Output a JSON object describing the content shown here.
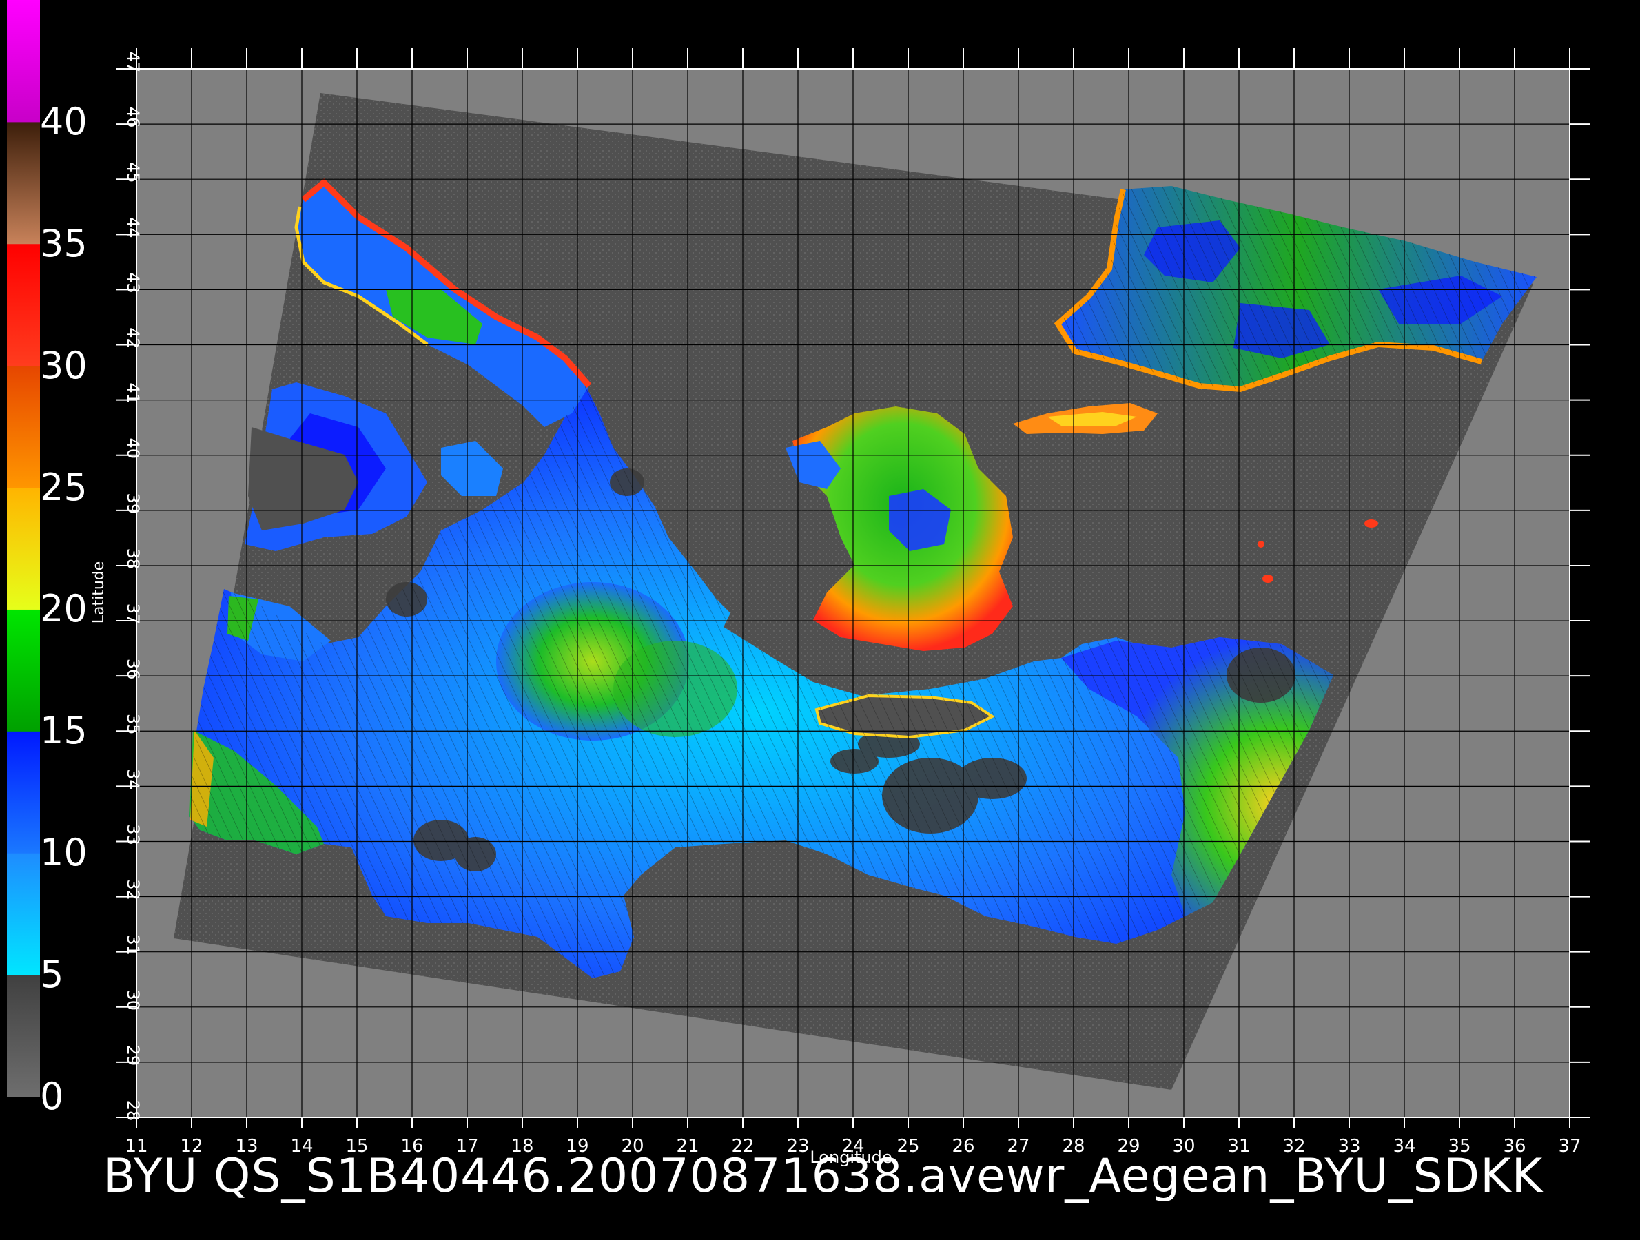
{
  "title": "BYU  QS_S1B40446.20070871638.avewr_Aegean_BYU_SDKK",
  "colorbar": {
    "labels": [
      "0",
      "5",
      "10",
      "15",
      "20",
      "25",
      "30",
      "35",
      "40"
    ],
    "segments": [
      {
        "from": 0,
        "to": 5,
        "colors": [
          "#6e6e6e",
          "#404040"
        ]
      },
      {
        "from": 5,
        "to": 10,
        "colors": [
          "#00e6ff",
          "#1e8cff"
        ]
      },
      {
        "from": 10,
        "to": 15,
        "colors": [
          "#1a78ff",
          "#0019ff"
        ]
      },
      {
        "from": 15,
        "to": 20,
        "colors": [
          "#00a000",
          "#00e600"
        ]
      },
      {
        "from": 20,
        "to": 25,
        "colors": [
          "#e6ff1a",
          "#ffb400"
        ]
      },
      {
        "from": 25,
        "to": 30,
        "colors": [
          "#ff9600",
          "#e64600"
        ]
      },
      {
        "from": 30,
        "to": 35,
        "colors": [
          "#ff3c1e",
          "#ff0000"
        ]
      },
      {
        "from": 35,
        "to": 40,
        "colors": [
          "#c8825a",
          "#3c1e0a"
        ]
      },
      {
        "from": 40,
        "to": 45,
        "colors": [
          "#c800c8",
          "#ff00ff"
        ]
      }
    ]
  },
  "axes": {
    "xlabel": "Longitude",
    "ylabel": "Latitude",
    "lon_range": [
      11,
      37
    ],
    "lat_range": [
      28,
      47
    ],
    "lon_ticks": [
      "11",
      "12",
      "13",
      "14",
      "15",
      "16",
      "17",
      "18",
      "19",
      "20",
      "21",
      "22",
      "23",
      "24",
      "25",
      "26",
      "27",
      "28",
      "29",
      "30",
      "31",
      "32",
      "33",
      "34",
      "35",
      "36",
      "37"
    ],
    "lat_ticks": [
      "28",
      "29",
      "30",
      "31",
      "32",
      "33",
      "34",
      "35",
      "36",
      "37",
      "38",
      "39",
      "40",
      "41",
      "42",
      "43",
      "44",
      "45",
      "46",
      "47"
    ]
  },
  "colors": {
    "background": "#000000",
    "land": "#808080",
    "swath": "#505050",
    "grid": "#000000"
  }
}
